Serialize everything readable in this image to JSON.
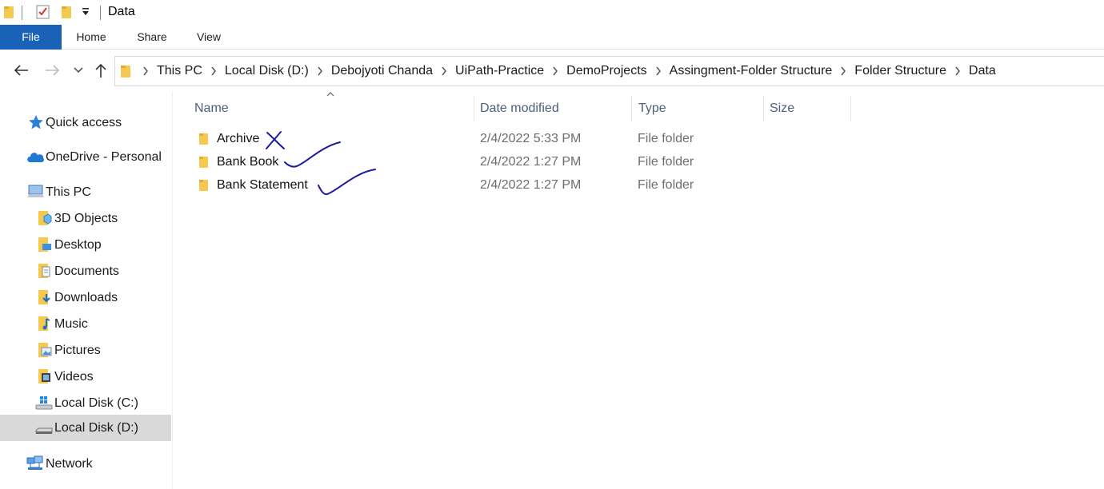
{
  "window": {
    "title": "Data"
  },
  "ribbon": {
    "tabs": [
      "File",
      "Home",
      "Share",
      "View"
    ]
  },
  "address": {
    "crumbs": [
      "This PC",
      "Local Disk (D:)",
      "Debojyoti Chanda",
      "UiPath-Practice",
      "DemoProjects",
      "Assingment-Folder Structure",
      "Folder Structure",
      "Data"
    ]
  },
  "sidebar": {
    "items": [
      {
        "label": "Quick access",
        "icon": "star-icon"
      },
      {
        "label": "OneDrive - Personal",
        "icon": "cloud-icon"
      },
      {
        "label": "This PC",
        "icon": "computer-icon"
      },
      {
        "label": "3D Objects",
        "icon": "3d-objects-icon"
      },
      {
        "label": "Desktop",
        "icon": "desktop-folder-icon"
      },
      {
        "label": "Documents",
        "icon": "documents-folder-icon"
      },
      {
        "label": "Downloads",
        "icon": "downloads-folder-icon"
      },
      {
        "label": "Music",
        "icon": "music-folder-icon"
      },
      {
        "label": "Pictures",
        "icon": "pictures-folder-icon"
      },
      {
        "label": "Videos",
        "icon": "videos-folder-icon"
      },
      {
        "label": "Local Disk (C:)",
        "icon": "windows-drive-icon"
      },
      {
        "label": "Local Disk (D:)",
        "icon": "drive-icon",
        "selected": true
      },
      {
        "label": "Network",
        "icon": "network-icon"
      }
    ]
  },
  "columns": {
    "name": "Name",
    "date": "Date modified",
    "type": "Type",
    "size": "Size"
  },
  "files": [
    {
      "name": "Archive",
      "date": "2/4/2022 5:33 PM",
      "type": "File folder",
      "annotation": "cross"
    },
    {
      "name": "Bank Book",
      "date": "2/4/2022 1:27 PM",
      "type": "File folder",
      "annotation": "check"
    },
    {
      "name": "Bank Statement",
      "date": "2/4/2022 1:27 PM",
      "type": "File folder",
      "annotation": "check"
    }
  ],
  "colors": {
    "accent": "#1a62b8",
    "folder": "#f5c94f",
    "ink": "#1a1a9e",
    "selection": "#d9d9d9"
  }
}
